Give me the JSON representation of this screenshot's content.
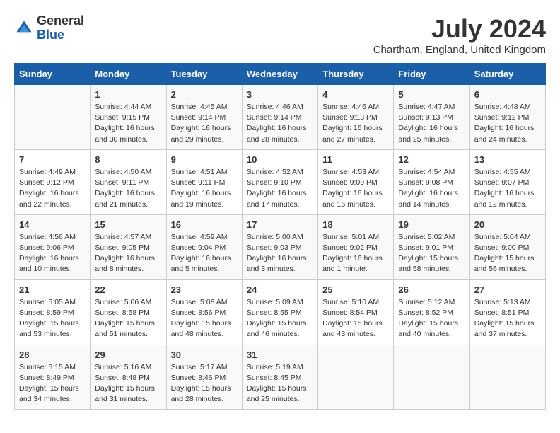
{
  "header": {
    "logo_line1": "General",
    "logo_line2": "Blue",
    "month_year": "July 2024",
    "location": "Chartham, England, United Kingdom"
  },
  "weekdays": [
    "Sunday",
    "Monday",
    "Tuesday",
    "Wednesday",
    "Thursday",
    "Friday",
    "Saturday"
  ],
  "weeks": [
    [
      {
        "day": "",
        "info": ""
      },
      {
        "day": "1",
        "info": "Sunrise: 4:44 AM\nSunset: 9:15 PM\nDaylight: 16 hours\nand 30 minutes."
      },
      {
        "day": "2",
        "info": "Sunrise: 4:45 AM\nSunset: 9:14 PM\nDaylight: 16 hours\nand 29 minutes."
      },
      {
        "day": "3",
        "info": "Sunrise: 4:46 AM\nSunset: 9:14 PM\nDaylight: 16 hours\nand 28 minutes."
      },
      {
        "day": "4",
        "info": "Sunrise: 4:46 AM\nSunset: 9:13 PM\nDaylight: 16 hours\nand 27 minutes."
      },
      {
        "day": "5",
        "info": "Sunrise: 4:47 AM\nSunset: 9:13 PM\nDaylight: 16 hours\nand 25 minutes."
      },
      {
        "day": "6",
        "info": "Sunrise: 4:48 AM\nSunset: 9:12 PM\nDaylight: 16 hours\nand 24 minutes."
      }
    ],
    [
      {
        "day": "7",
        "info": "Sunrise: 4:49 AM\nSunset: 9:12 PM\nDaylight: 16 hours\nand 22 minutes."
      },
      {
        "day": "8",
        "info": "Sunrise: 4:50 AM\nSunset: 9:11 PM\nDaylight: 16 hours\nand 21 minutes."
      },
      {
        "day": "9",
        "info": "Sunrise: 4:51 AM\nSunset: 9:11 PM\nDaylight: 16 hours\nand 19 minutes."
      },
      {
        "day": "10",
        "info": "Sunrise: 4:52 AM\nSunset: 9:10 PM\nDaylight: 16 hours\nand 17 minutes."
      },
      {
        "day": "11",
        "info": "Sunrise: 4:53 AM\nSunset: 9:09 PM\nDaylight: 16 hours\nand 16 minutes."
      },
      {
        "day": "12",
        "info": "Sunrise: 4:54 AM\nSunset: 9:08 PM\nDaylight: 16 hours\nand 14 minutes."
      },
      {
        "day": "13",
        "info": "Sunrise: 4:55 AM\nSunset: 9:07 PM\nDaylight: 16 hours\nand 12 minutes."
      }
    ],
    [
      {
        "day": "14",
        "info": "Sunrise: 4:56 AM\nSunset: 9:06 PM\nDaylight: 16 hours\nand 10 minutes."
      },
      {
        "day": "15",
        "info": "Sunrise: 4:57 AM\nSunset: 9:05 PM\nDaylight: 16 hours\nand 8 minutes."
      },
      {
        "day": "16",
        "info": "Sunrise: 4:59 AM\nSunset: 9:04 PM\nDaylight: 16 hours\nand 5 minutes."
      },
      {
        "day": "17",
        "info": "Sunrise: 5:00 AM\nSunset: 9:03 PM\nDaylight: 16 hours\nand 3 minutes."
      },
      {
        "day": "18",
        "info": "Sunrise: 5:01 AM\nSunset: 9:02 PM\nDaylight: 16 hours\nand 1 minute."
      },
      {
        "day": "19",
        "info": "Sunrise: 5:02 AM\nSunset: 9:01 PM\nDaylight: 15 hours\nand 58 minutes."
      },
      {
        "day": "20",
        "info": "Sunrise: 5:04 AM\nSunset: 9:00 PM\nDaylight: 15 hours\nand 56 minutes."
      }
    ],
    [
      {
        "day": "21",
        "info": "Sunrise: 5:05 AM\nSunset: 8:59 PM\nDaylight: 15 hours\nand 53 minutes."
      },
      {
        "day": "22",
        "info": "Sunrise: 5:06 AM\nSunset: 8:58 PM\nDaylight: 15 hours\nand 51 minutes."
      },
      {
        "day": "23",
        "info": "Sunrise: 5:08 AM\nSunset: 8:56 PM\nDaylight: 15 hours\nand 48 minutes."
      },
      {
        "day": "24",
        "info": "Sunrise: 5:09 AM\nSunset: 8:55 PM\nDaylight: 15 hours\nand 46 minutes."
      },
      {
        "day": "25",
        "info": "Sunrise: 5:10 AM\nSunset: 8:54 PM\nDaylight: 15 hours\nand 43 minutes."
      },
      {
        "day": "26",
        "info": "Sunrise: 5:12 AM\nSunset: 8:52 PM\nDaylight: 15 hours\nand 40 minutes."
      },
      {
        "day": "27",
        "info": "Sunrise: 5:13 AM\nSunset: 8:51 PM\nDaylight: 15 hours\nand 37 minutes."
      }
    ],
    [
      {
        "day": "28",
        "info": "Sunrise: 5:15 AM\nSunset: 8:49 PM\nDaylight: 15 hours\nand 34 minutes."
      },
      {
        "day": "29",
        "info": "Sunrise: 5:16 AM\nSunset: 8:48 PM\nDaylight: 15 hours\nand 31 minutes."
      },
      {
        "day": "30",
        "info": "Sunrise: 5:17 AM\nSunset: 8:46 PM\nDaylight: 15 hours\nand 28 minutes."
      },
      {
        "day": "31",
        "info": "Sunrise: 5:19 AM\nSunset: 8:45 PM\nDaylight: 15 hours\nand 25 minutes."
      },
      {
        "day": "",
        "info": ""
      },
      {
        "day": "",
        "info": ""
      },
      {
        "day": "",
        "info": ""
      }
    ]
  ]
}
